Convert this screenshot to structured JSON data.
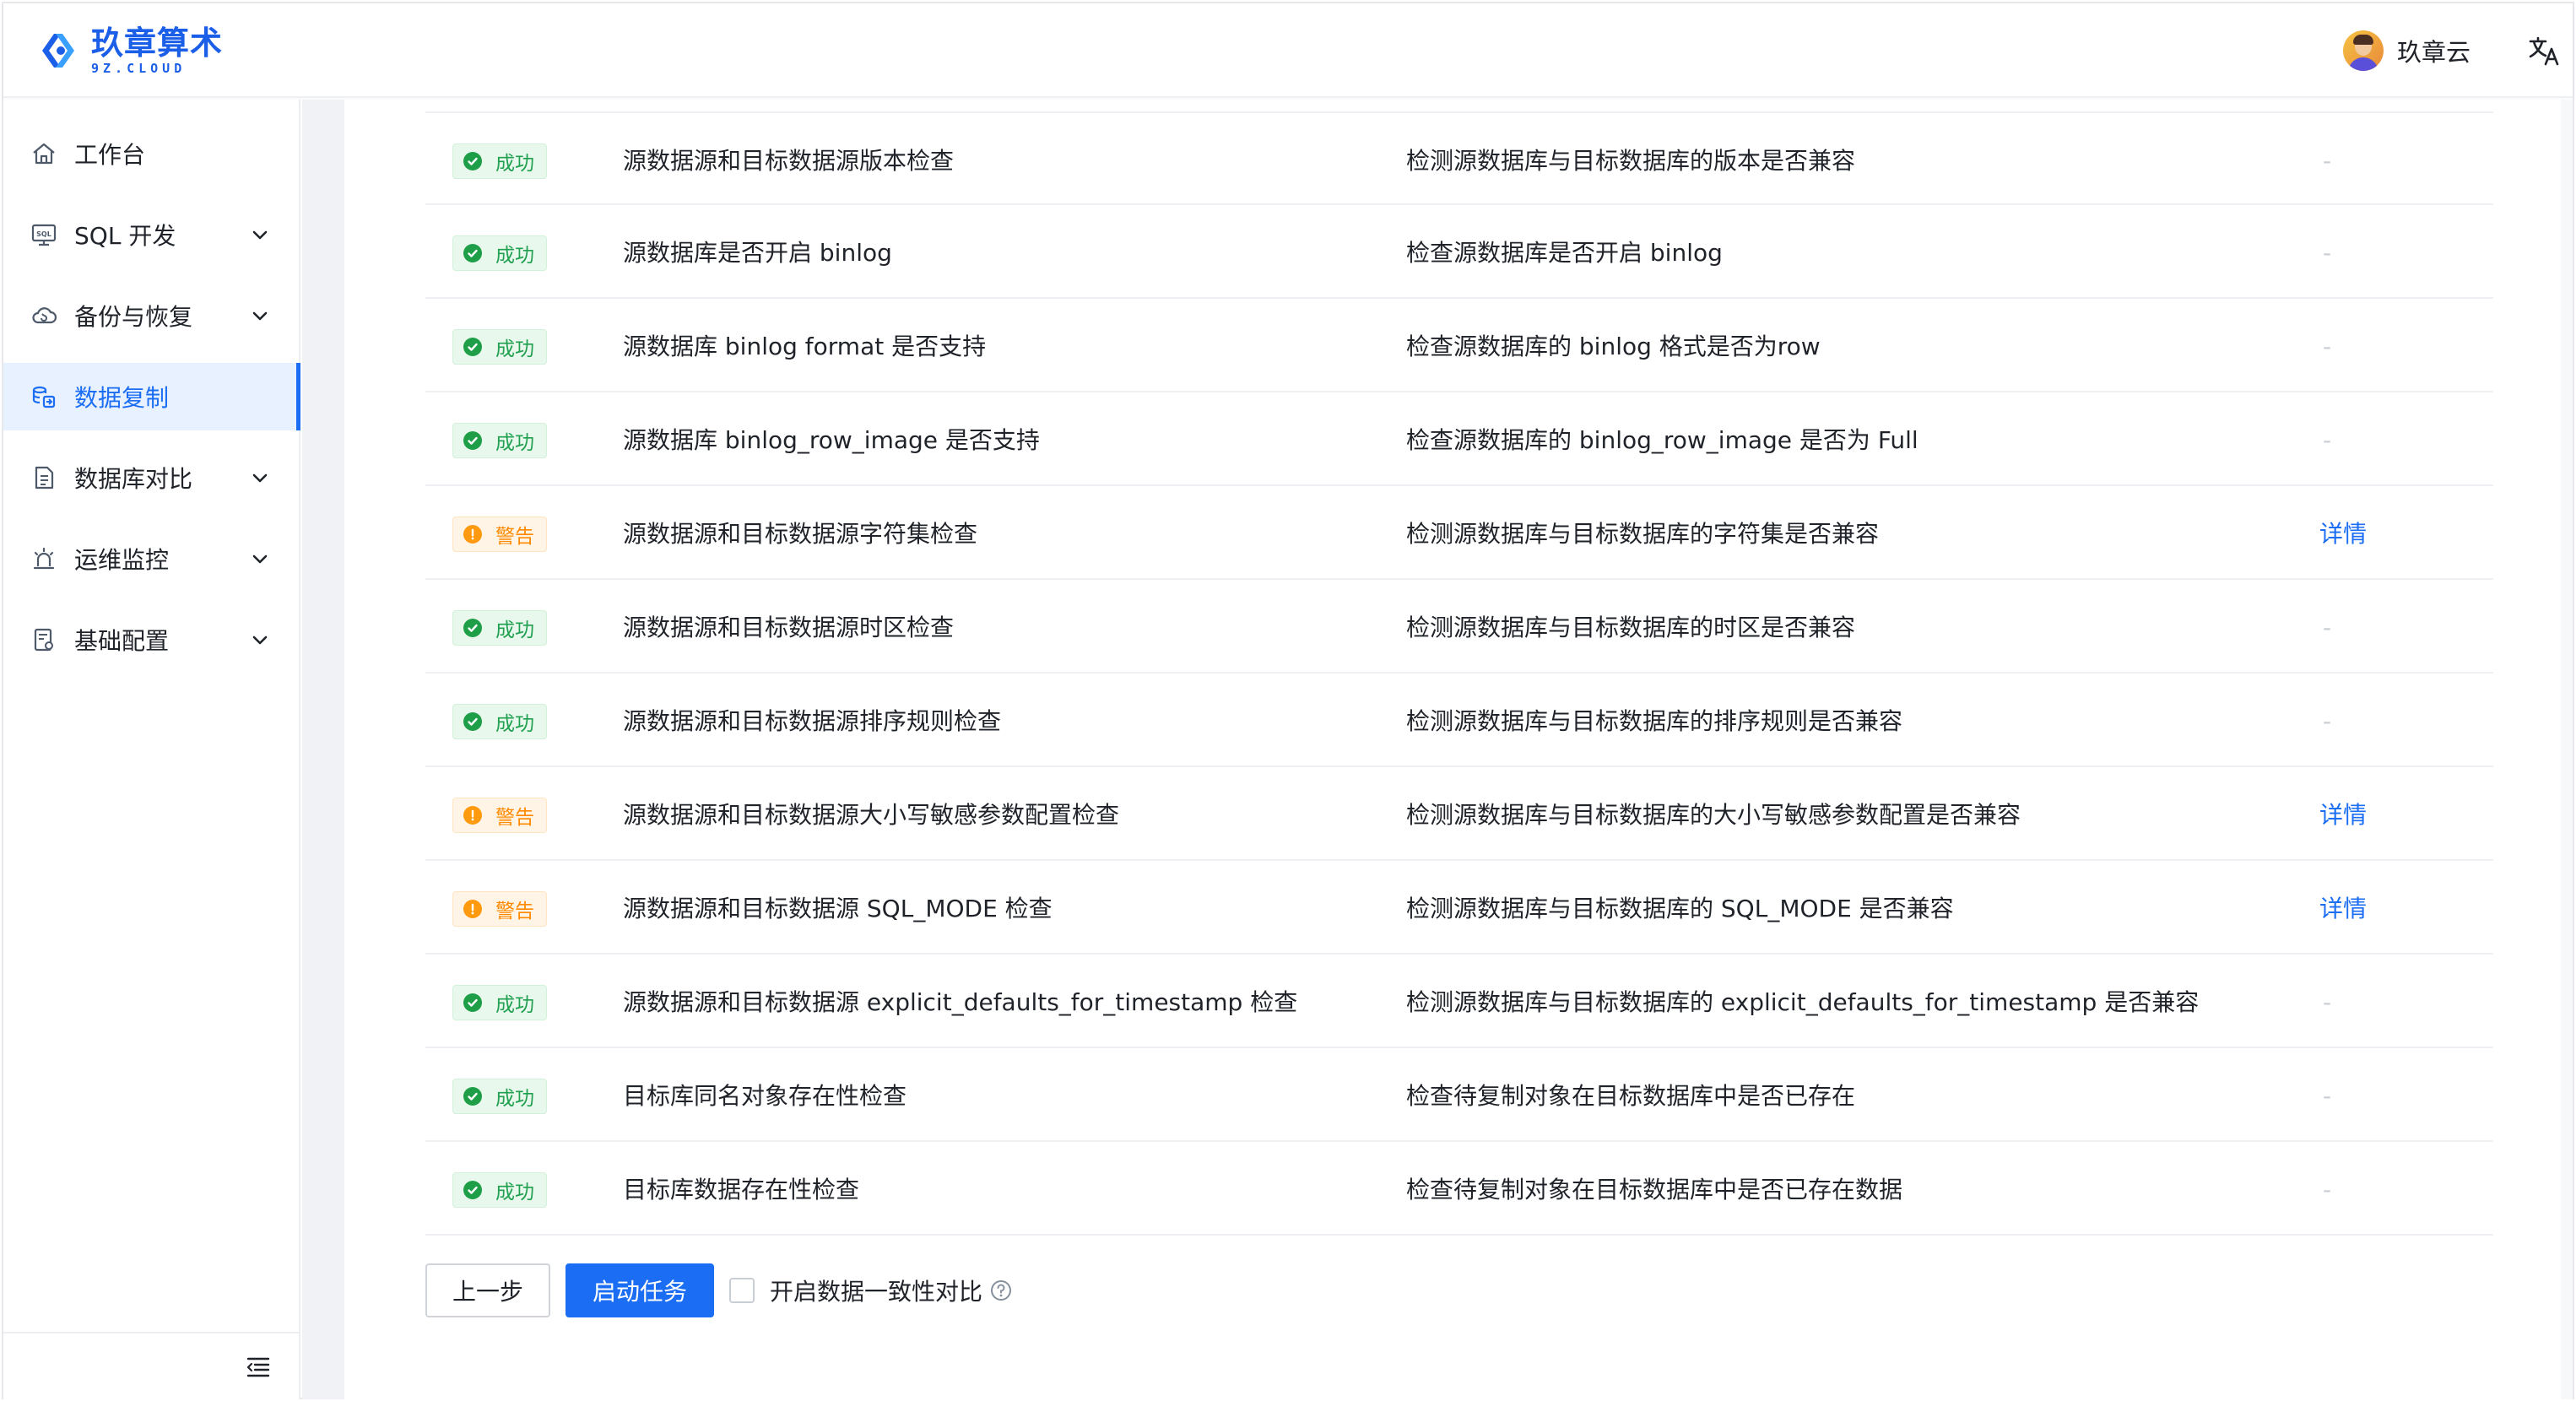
{
  "header": {
    "logo_cn": "玖章算术",
    "logo_en": "9Z.CLOUD",
    "user_name": "玖章云"
  },
  "sidebar": {
    "items": [
      {
        "label": "工作台",
        "icon": "home-icon",
        "has_children": false,
        "active": false
      },
      {
        "label": "SQL 开发",
        "icon": "sql-icon",
        "has_children": true,
        "active": false
      },
      {
        "label": "备份与恢复",
        "icon": "cloud-backup-icon",
        "has_children": true,
        "active": false
      },
      {
        "label": "数据复制",
        "icon": "data-copy-icon",
        "has_children": false,
        "active": true
      },
      {
        "label": "数据库对比",
        "icon": "compare-icon",
        "has_children": true,
        "active": false
      },
      {
        "label": "运维监控",
        "icon": "alarm-icon",
        "has_children": true,
        "active": false
      },
      {
        "label": "基础配置",
        "icon": "config-icon",
        "has_children": true,
        "active": false
      }
    ]
  },
  "checks": [
    {
      "status": "success",
      "status_label": "成功",
      "name": "源数据源和目标数据源版本检查",
      "desc": "检测源数据库与目标数据库的版本是否兼容",
      "action": "-"
    },
    {
      "status": "success",
      "status_label": "成功",
      "name": "源数据库是否开启 binlog",
      "desc": "检查源数据库是否开启 binlog",
      "action": "-"
    },
    {
      "status": "success",
      "status_label": "成功",
      "name": "源数据库 binlog format 是否支持",
      "desc": "检查源数据库的 binlog 格式是否为row",
      "action": "-"
    },
    {
      "status": "success",
      "status_label": "成功",
      "name": "源数据库 binlog_row_image 是否支持",
      "desc": "检查源数据库的 binlog_row_image 是否为 Full",
      "action": "-"
    },
    {
      "status": "warning",
      "status_label": "警告",
      "name": "源数据源和目标数据源字符集检查",
      "desc": "检测源数据库与目标数据库的字符集是否兼容",
      "action": "详情"
    },
    {
      "status": "success",
      "status_label": "成功",
      "name": "源数据源和目标数据源时区检查",
      "desc": "检测源数据库与目标数据库的时区是否兼容",
      "action": "-"
    },
    {
      "status": "success",
      "status_label": "成功",
      "name": "源数据源和目标数据源排序规则检查",
      "desc": "检测源数据库与目标数据库的排序规则是否兼容",
      "action": "-"
    },
    {
      "status": "warning",
      "status_label": "警告",
      "name": "源数据源和目标数据源大小写敏感参数配置检查",
      "desc": "检测源数据库与目标数据库的大小写敏感参数配置是否兼容",
      "action": "详情"
    },
    {
      "status": "warning",
      "status_label": "警告",
      "name": "源数据源和目标数据源 SQL_MODE 检查",
      "desc": "检测源数据库与目标数据库的 SQL_MODE 是否兼容",
      "action": "详情"
    },
    {
      "status": "success",
      "status_label": "成功",
      "name": "源数据源和目标数据源 explicit_defaults_for_timestamp 检查",
      "desc": "检测源数据库与目标数据库的 explicit_defaults_for_timestamp 是否兼容",
      "action": "-"
    },
    {
      "status": "success",
      "status_label": "成功",
      "name": "目标库同名对象存在性检查",
      "desc": "检查待复制对象在目标数据库中是否已存在",
      "action": "-"
    },
    {
      "status": "success",
      "status_label": "成功",
      "name": "目标库数据存在性检查",
      "desc": "检查待复制对象在目标数据库中是否已存在数据",
      "action": "-"
    }
  ],
  "footer_actions": {
    "prev_label": "上一步",
    "start_label": "启动任务",
    "consistency_label": "开启数据一致性对比",
    "consistency_checked": false
  },
  "colors": {
    "primary": "#1b6ef3",
    "success": "#20a050",
    "warning": "#ff8a00"
  }
}
